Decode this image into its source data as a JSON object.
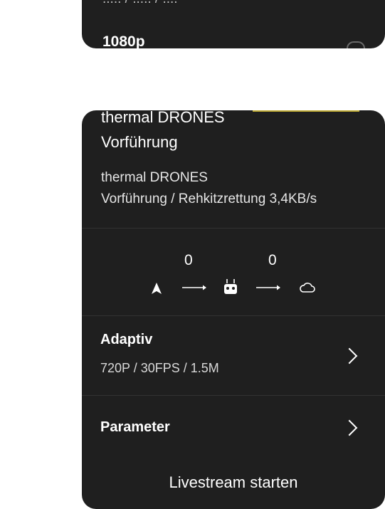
{
  "top_card": {
    "resolution_label": "1080p",
    "cut_text": "..... /  ..... / ...."
  },
  "stream_card": {
    "title_line1": "thermal DRONES",
    "title_line2": "Vorführung",
    "subtitle_line1": "thermal DRONES",
    "subtitle_line2": "Vorführung / Rehkitzrettung 3,4KB/s",
    "flow": {
      "drone_count": "0",
      "remote_count": "0",
      "icons": [
        "navigation-arrow-icon",
        "arrow-right-icon",
        "remote-controller-icon",
        "arrow-right-icon",
        "cloud-icon"
      ]
    },
    "quality": {
      "label": "Adaptiv",
      "value": "720P / 30FPS / 1.5M"
    },
    "parameter": {
      "label": "Parameter"
    },
    "start_label": "Livestream starten"
  },
  "colors": {
    "card_background": "#1f1f1f",
    "divider": "#323232",
    "page_background": "#ffffff",
    "accent_line": "#d8c23a"
  }
}
